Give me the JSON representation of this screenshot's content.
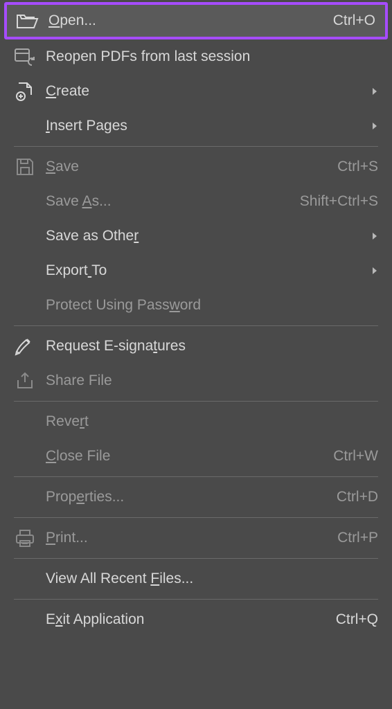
{
  "menu": {
    "open": {
      "label": "Open...",
      "shortcut": "Ctrl+O",
      "mn": 0,
      "enabled": true,
      "icon": "folder-open-icon"
    },
    "reopen": {
      "label": "Reopen PDFs from last session",
      "shortcut": "",
      "mn": -1,
      "enabled": true,
      "icon": "reopen-pdf-icon"
    },
    "create": {
      "label": "Create",
      "shortcut": "",
      "mn": 0,
      "enabled": true,
      "icon": "create-file-icon",
      "submenu": true
    },
    "insert": {
      "label": "Insert Pages",
      "shortcut": "",
      "mn": 0,
      "enabled": true,
      "icon": "",
      "submenu": true
    },
    "save": {
      "label": "Save",
      "shortcut": "Ctrl+S",
      "mn": 0,
      "enabled": false,
      "icon": "save-disk-icon"
    },
    "saveas": {
      "label": "Save As...",
      "shortcut": "Shift+Ctrl+S",
      "mn": 5,
      "enabled": false,
      "icon": ""
    },
    "saveother": {
      "label": "Save as Other",
      "shortcut": "",
      "mn": 12,
      "enabled": true,
      "icon": "",
      "submenu": true
    },
    "export": {
      "label": "Export To",
      "shortcut": "",
      "mn": 6,
      "enabled": true,
      "icon": "",
      "submenu": true
    },
    "protect": {
      "label": "Protect Using Password",
      "shortcut": "",
      "mn": 18,
      "enabled": false,
      "icon": ""
    },
    "esign": {
      "label": "Request E-signatures",
      "shortcut": "",
      "mn": 15,
      "enabled": true,
      "icon": "signature-pen-icon"
    },
    "share": {
      "label": "Share File",
      "shortcut": "",
      "mn": -1,
      "enabled": false,
      "icon": "share-upload-icon"
    },
    "revert": {
      "label": "Revert",
      "shortcut": "",
      "mn": 4,
      "enabled": false,
      "icon": ""
    },
    "close": {
      "label": "Close File",
      "shortcut": "Ctrl+W",
      "mn": 0,
      "enabled": false,
      "icon": ""
    },
    "properties": {
      "label": "Properties...",
      "shortcut": "Ctrl+D",
      "mn": 4,
      "enabled": false,
      "icon": ""
    },
    "print": {
      "label": "Print...",
      "shortcut": "Ctrl+P",
      "mn": 0,
      "enabled": false,
      "icon": "print-icon"
    },
    "recent": {
      "label": "View All Recent Files...",
      "shortcut": "",
      "mn": 16,
      "enabled": true,
      "icon": ""
    },
    "exit": {
      "label": "Exit Application",
      "shortcut": "Ctrl+Q",
      "mn": 1,
      "enabled": true,
      "icon": ""
    }
  },
  "layout_order": [
    "open",
    "reopen",
    "create",
    "insert",
    "--",
    "save",
    "saveas",
    "saveother",
    "export",
    "protect",
    "--",
    "esign",
    "share",
    "--",
    "revert",
    "close",
    "--",
    "properties",
    "--",
    "print",
    "--",
    "recent",
    "--",
    "exit"
  ]
}
